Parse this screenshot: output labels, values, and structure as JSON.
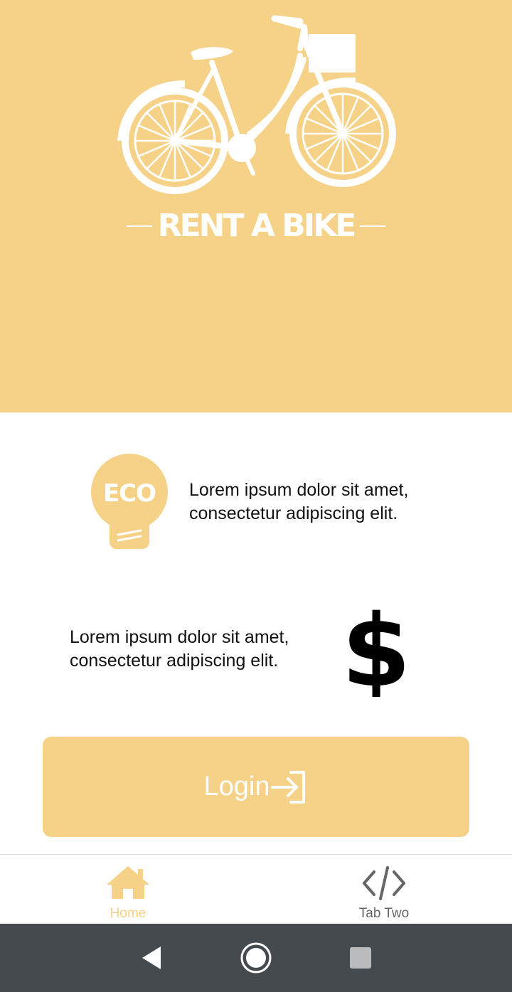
{
  "hero": {
    "brand_text": "RENT A BIKE",
    "background_color": "#f6d288"
  },
  "features": [
    {
      "icon": "eco-bulb-icon",
      "text": "Lorem ipsum dolor sit amet, consectetur adipiscing elit."
    },
    {
      "icon": "dollar-icon",
      "text": "Lorem ipsum dolor sit amet, consectetur adipiscing elit."
    }
  ],
  "eco_badge_text": "ECO",
  "login_button": {
    "label": "Login",
    "icon": "login-arrow-icon"
  },
  "tabs": [
    {
      "label": "Home",
      "icon": "home-icon",
      "active": true
    },
    {
      "label": "Tab Two",
      "icon": "code-icon",
      "active": false
    }
  ],
  "system_nav": {
    "back": "back-triangle-icon",
    "home": "home-circle-icon",
    "recents": "recents-square-icon"
  },
  "colors": {
    "accent": "#f6d288",
    "nav_bar": "#454a4e",
    "inactive_tab": "#666666"
  }
}
